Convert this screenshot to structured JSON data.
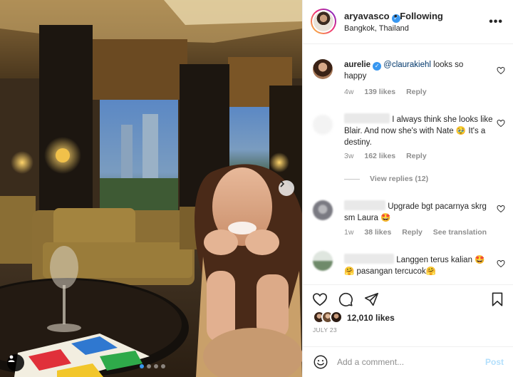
{
  "header": {
    "username": "aryavasco",
    "separator": "•",
    "follow_status": "Following",
    "location": "Bangkok, Thailand"
  },
  "comments": [
    {
      "username": "aurelie",
      "verified": true,
      "mention": "@claurakiehl",
      "text": " looks so happy",
      "age": "4w",
      "likes": "139 likes",
      "reply": "Reply"
    },
    {
      "text": "I always think she looks like Blair. And now she's with Nate 🥹 It's a destiny.",
      "age": "3w",
      "likes": "162 likes",
      "reply": "Reply",
      "view_replies": "View replies (12)"
    },
    {
      "text": "Upgrade bgt pacarnya skrg sm Laura 🤩",
      "age": "1w",
      "likes": "38 likes",
      "reply": "Reply",
      "translation": "See translation"
    },
    {
      "text": "Langgen terus kalian 🤩🤗 pasangan tercucok🤗"
    }
  ],
  "post": {
    "likes_count": "12,010",
    "likes_label": "likes",
    "date": "JULY 23"
  },
  "composer": {
    "placeholder": "Add a comment...",
    "post_label": "Post"
  },
  "icons": {
    "like": "heart-icon",
    "comment": "comment-icon",
    "share": "paper-plane-icon",
    "save": "bookmark-icon",
    "emoji": "emoji-icon",
    "more": "more-options-icon",
    "next": "chevron-right-icon",
    "tag": "user-tag-icon"
  },
  "colors": {
    "verified": "#3897f0",
    "mention": "#00376b",
    "muted": "#8e8e8e",
    "post_disabled": "#b2dffc"
  },
  "carousel": {
    "total": 4,
    "active": 1
  }
}
